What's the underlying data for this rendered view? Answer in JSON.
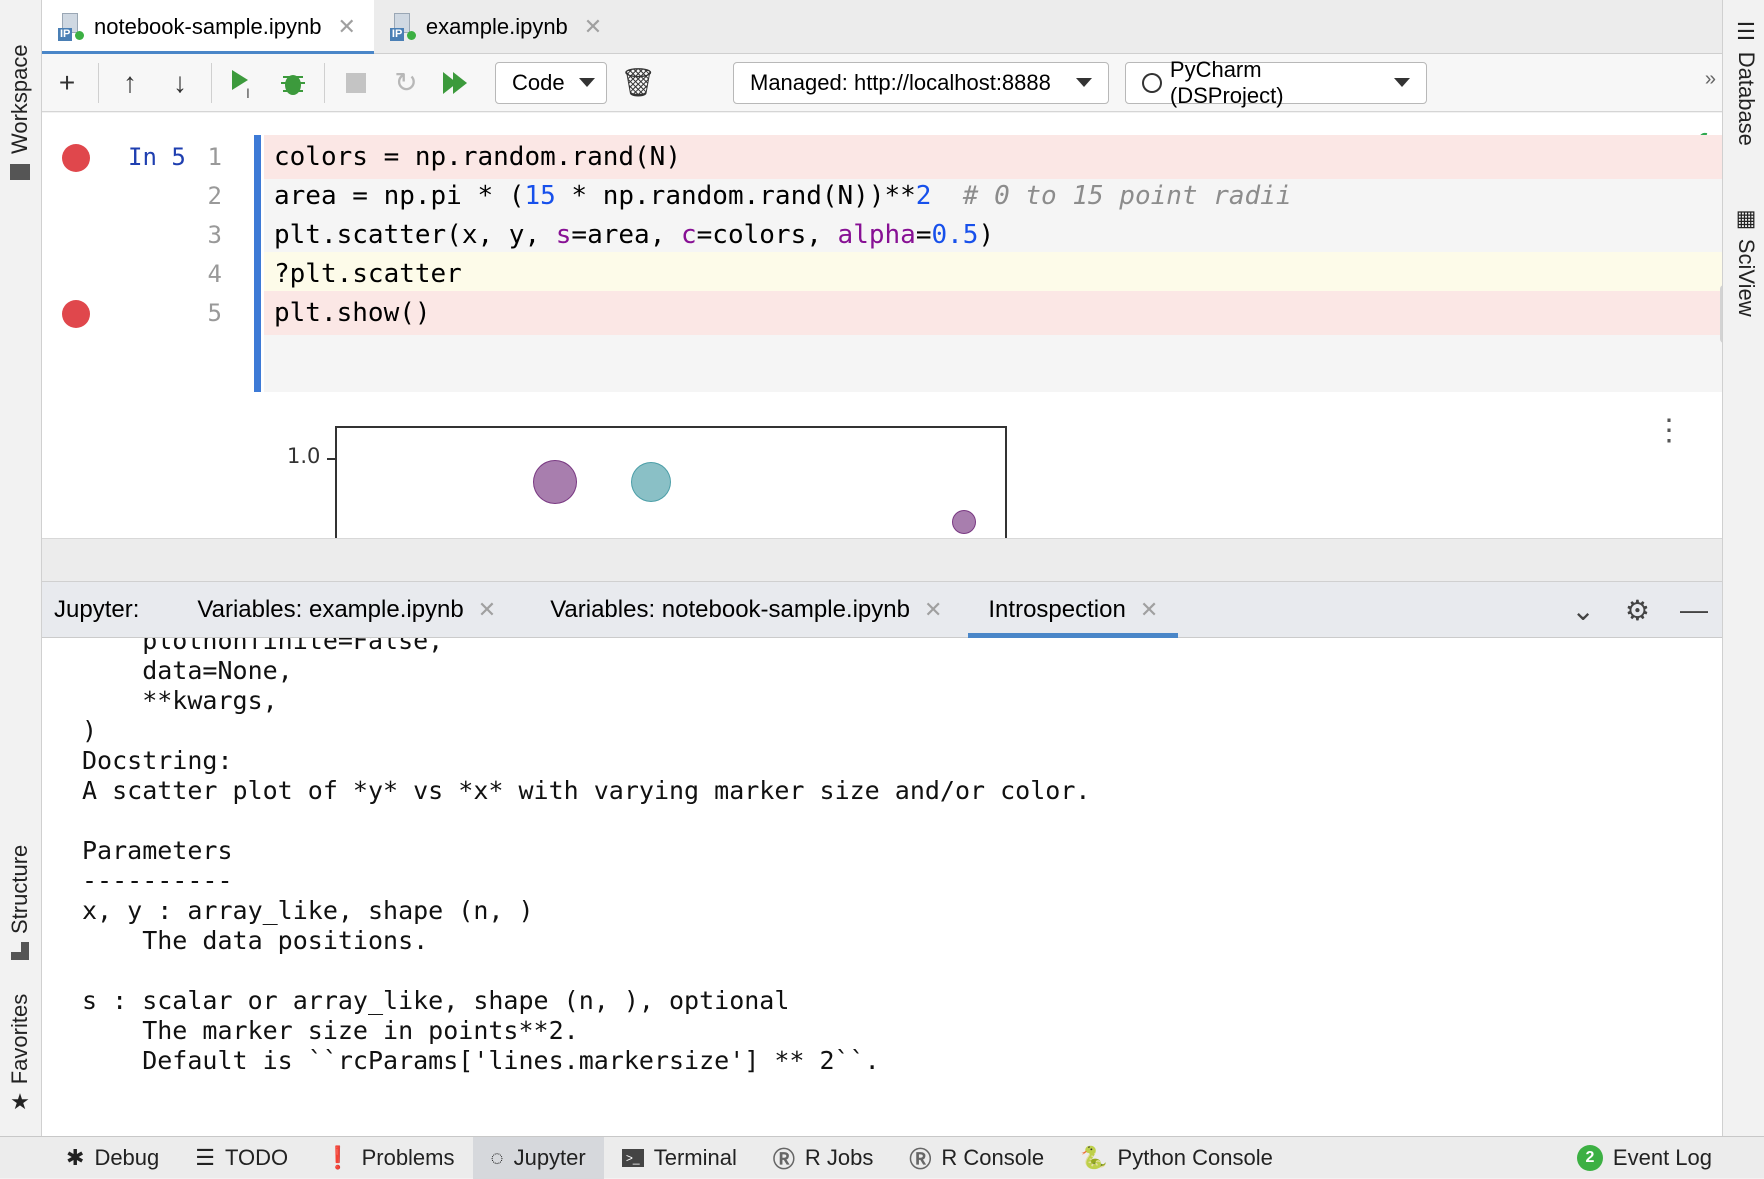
{
  "left_strip": {
    "workspace": "Workspace",
    "structure": "Structure",
    "favorites": "Favorites"
  },
  "right_strip": {
    "database": "Database",
    "sciview": "SciView"
  },
  "editor_tabs": [
    {
      "label": "notebook-sample.ipynb",
      "active": true
    },
    {
      "label": "example.ipynb",
      "active": false
    }
  ],
  "toolbar": {
    "cell_type": "Code",
    "server": "Managed: http://localhost:8888",
    "kernel": "PyCharm (DSProject)"
  },
  "cell": {
    "prompt": "In 5",
    "line_numbers": [
      "1",
      "2",
      "3",
      "4",
      "5"
    ]
  },
  "plot": {
    "y_tick": "1.0"
  },
  "tool_window": {
    "title": "Jupyter:",
    "tabs": [
      "Variables: example.ipynb",
      "Variables: notebook-sample.ipynb",
      "Introspection"
    ],
    "active_tab": "Introspection",
    "doc_lines": [
      "    plotnonfinite=False,",
      "    data=None,",
      "    **kwargs,",
      ")",
      "Docstring:",
      "A scatter plot of *y* vs *x* with varying marker size and/or color.",
      "",
      "Parameters",
      "----------",
      "x, y : array_like, shape (n, )",
      "    The data positions.",
      "",
      "s : scalar or array_like, shape (n, ), optional",
      "    The marker size in points**2.",
      "    Default is ``rcParams['lines.markersize'] ** 2``."
    ]
  },
  "bottom_bar": {
    "debug": "Debug",
    "todo": "TODO",
    "problems": "Problems",
    "jupyter": "Jupyter",
    "terminal": "Terminal",
    "r_jobs": "R Jobs",
    "r_console": "R Console",
    "python_console": "Python Console",
    "event_log": "Event Log",
    "event_count": "2"
  }
}
